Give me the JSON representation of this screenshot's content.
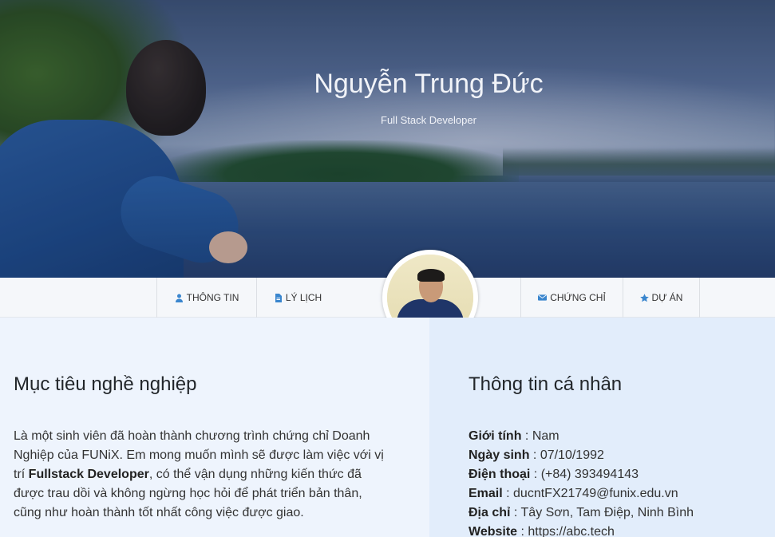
{
  "hero": {
    "name": "Nguyễn Trung Đức",
    "role": "Full Stack Developer"
  },
  "nav": {
    "items": [
      {
        "label": "THÔNG TIN",
        "icon": "user-icon"
      },
      {
        "label": "LÝ LỊCH",
        "icon": "file-icon"
      },
      {
        "label": "CHỨNG CHỈ",
        "icon": "envelope-icon"
      },
      {
        "label": "DỰ ÁN",
        "icon": "star-icon"
      }
    ]
  },
  "objective": {
    "title": "Mục tiêu nghề nghiệp",
    "text_before": "Là một sinh viên đã hoàn thành chương trình chứng chỉ Doanh Nghiệp của FUNiX. Em mong muốn mình sẽ được làm việc với vị trí ",
    "highlight": "Fullstack Developer",
    "text_after": ", có thể vận dụng những kiến thức đã được trau dồi và không ngừng học hỏi để phát triển bản thân, cũng như hoàn thành tốt nhất công việc được giao."
  },
  "personal": {
    "title": "Thông tin cá nhân",
    "rows": [
      {
        "key": "Giới tính",
        "value": "Nam"
      },
      {
        "key": "Ngày sinh",
        "value": "07/10/1992"
      },
      {
        "key": "Điện thoại",
        "value": "(+84) 393494143"
      },
      {
        "key": "Email",
        "value": "ducntFX21749@funix.edu.vn"
      },
      {
        "key": "Địa chỉ",
        "value": "Tây Sơn, Tam Điệp, Ninh Bình"
      },
      {
        "key": "Website",
        "value": "https://abc.tech"
      }
    ]
  },
  "colors": {
    "accent": "#3a86ce",
    "left_bg": "#eef4fd",
    "right_bg": "#e2edfb"
  }
}
